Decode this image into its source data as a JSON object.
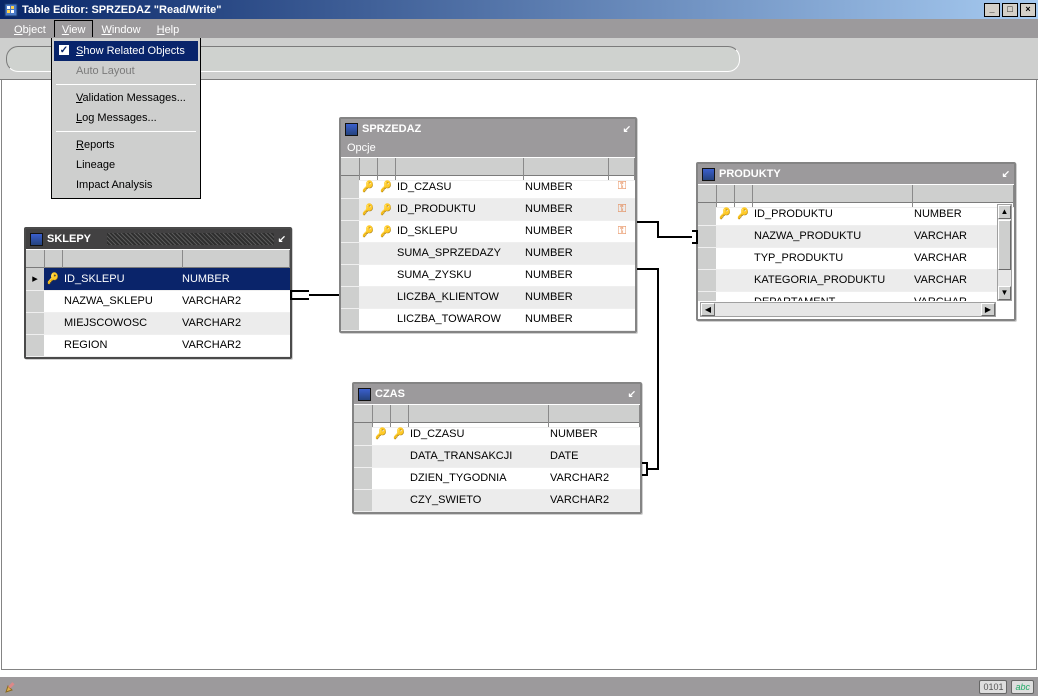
{
  "window": {
    "title": "Table Editor: SPRZEDAZ \"Read/Write\""
  },
  "menubar": {
    "items": [
      "Object",
      "View",
      "Window",
      "Help"
    ],
    "active_index": 1
  },
  "view_menu": {
    "show_related_objects": "Show Related Objects",
    "auto_layout": "Auto Layout",
    "validation_messages": "Validation Messages...",
    "log_messages": "Log Messages...",
    "reports": "Reports",
    "lineage": "Lineage",
    "impact_analysis": "Impact Analysis"
  },
  "toolbar": {
    "input_value": ""
  },
  "tables": {
    "sklepy": {
      "title": "SKLEPY",
      "active": true,
      "columns": [
        {
          "name": "ID_SKLEPU",
          "type": "NUMBER",
          "pk": true,
          "selected": true
        },
        {
          "name": "NAZWA_SKLEPU",
          "type": "VARCHAR2"
        },
        {
          "name": "MIEJSCOWOSC",
          "type": "VARCHAR2"
        },
        {
          "name": "REGION",
          "type": "VARCHAR2"
        }
      ]
    },
    "sprzedaz": {
      "title": "SPRZEDAZ",
      "sub": "Opcje",
      "columns": [
        {
          "name": "ID_CZASU",
          "type": "NUMBER",
          "pk": true,
          "fk": true,
          "link": true
        },
        {
          "name": "ID_PRODUKTU",
          "type": "NUMBER",
          "pk": true,
          "fk": true,
          "link": true
        },
        {
          "name": "ID_SKLEPU",
          "type": "NUMBER",
          "pk": true,
          "fk": true,
          "link": true
        },
        {
          "name": "SUMA_SPRZEDAZY",
          "type": "NUMBER"
        },
        {
          "name": "SUMA_ZYSKU",
          "type": "NUMBER"
        },
        {
          "name": "LICZBA_KLIENTOW",
          "type": "NUMBER"
        },
        {
          "name": "LICZBA_TOWAROW",
          "type": "NUMBER"
        }
      ]
    },
    "produkty": {
      "title": "PRODUKTY",
      "columns": [
        {
          "name": "ID_PRODUKTU",
          "type": "NUMBER",
          "pk": true,
          "fk": true
        },
        {
          "name": "NAZWA_PRODUKTU",
          "type": "VARCHAR"
        },
        {
          "name": "TYP_PRODUKTU",
          "type": "VARCHAR"
        },
        {
          "name": "KATEGORIA_PRODUKTU",
          "type": "VARCHAR"
        },
        {
          "name": "DEPARTAMENT",
          "type": "VARCHAR",
          "partial": true
        }
      ]
    },
    "czas": {
      "title": "CZAS",
      "columns": [
        {
          "name": "ID_CZASU",
          "type": "NUMBER",
          "pk": true,
          "fk": true
        },
        {
          "name": "DATA_TRANSAKCJI",
          "type": "DATE"
        },
        {
          "name": "DZIEN_TYGODNIA",
          "type": "VARCHAR2"
        },
        {
          "name": "CZY_SWIETO",
          "type": "VARCHAR2"
        }
      ]
    }
  },
  "status": {
    "chip1": "0101",
    "chip2": "abc"
  }
}
